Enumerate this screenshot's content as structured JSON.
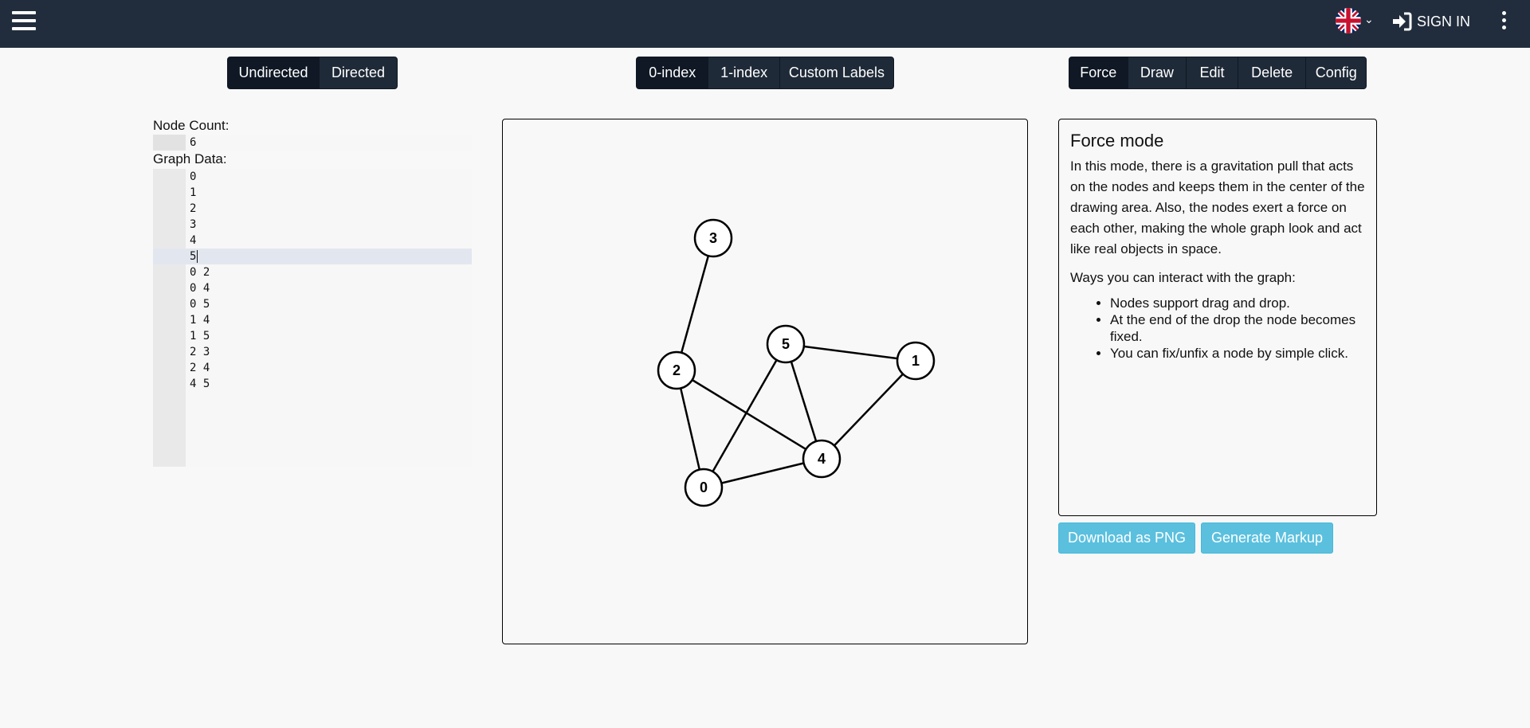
{
  "header": {
    "language_icon": "uk-flag-icon",
    "sign_in_label": "SIGN IN"
  },
  "direction_toggle": [
    "Undirected",
    "Directed"
  ],
  "index_toggle": [
    "0-index",
    "1-index",
    "Custom Labels"
  ],
  "mode_toggle": [
    "Force",
    "Draw",
    "Edit",
    "Delete",
    "Config"
  ],
  "editor": {
    "node_count_label": "Node Count:",
    "node_count_value": "6",
    "graph_data_label": "Graph Data:",
    "lines": [
      "0",
      "1",
      "2",
      "3",
      "4",
      "5",
      "0 2",
      "0 4",
      "0 5",
      "1 4",
      "1 5",
      "2 3",
      "2 4",
      "4 5"
    ]
  },
  "graph": {
    "nodes": [
      {
        "label": "3"
      },
      {
        "label": "5"
      },
      {
        "label": "1"
      },
      {
        "label": "2"
      },
      {
        "label": "4"
      },
      {
        "label": "0"
      }
    ]
  },
  "info": {
    "title": "Force mode",
    "description": "In this mode, there is a gravitation pull that acts on the nodes and keeps them in the center of the drawing area. Also, the nodes exert a force on each other, making the whole graph look and act like real objects in space.",
    "ways_heading": "Ways you can interact with the graph:",
    "items": [
      "Nodes support drag and drop.",
      "At the end of the drop the node becomes fixed.",
      "You can fix/unfix a node by simple click."
    ]
  },
  "actions": {
    "download_label": "Download as PNG",
    "markup_label": "Generate Markup"
  },
  "colors": {
    "topbar": "#212d3d",
    "button_dark": "#1f2a38",
    "button_active": "#0f1824",
    "info_button": "#5bc0de"
  }
}
